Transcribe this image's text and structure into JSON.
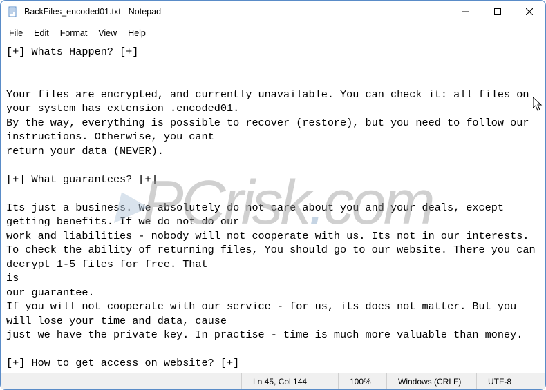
{
  "titlebar": {
    "title": "BackFiles_encoded01.txt - Notepad"
  },
  "menu": {
    "file": "File",
    "edit": "Edit",
    "format": "Format",
    "view": "View",
    "help": "Help"
  },
  "content": "[+] Whats Happen? [+]\n\n\nYour files are encrypted, and currently unavailable. You can check it: all files on your system has extension .encoded01.\nBy the way, everything is possible to recover (restore), but you need to follow our instructions. Otherwise, you cant\nreturn your data (NEVER).\n\n[+] What guarantees? [+]\n\nIts just a business. We absolutely do not care about you and your deals, except getting benefits. If we do not do our\nwork and liabilities - nobody will not cooperate with us. Its not in our interests.\nTo check the ability of returning files, You should go to our website. There you can decrypt 1-5 files for free. That\nis\nour guarantee.\nIf you will not cooperate with our service - for us, its does not matter. But you will lose your time and data, cause\njust we have the private key. In practise - time is much more valuable than money.\n\n[+] How to get access on website? [+]",
  "statusbar": {
    "position": "Ln 45, Col 144",
    "zoom": "100%",
    "line_ending": "Windows (CRLF)",
    "encoding": "UTF-8"
  },
  "watermark": "PCrisk.com"
}
